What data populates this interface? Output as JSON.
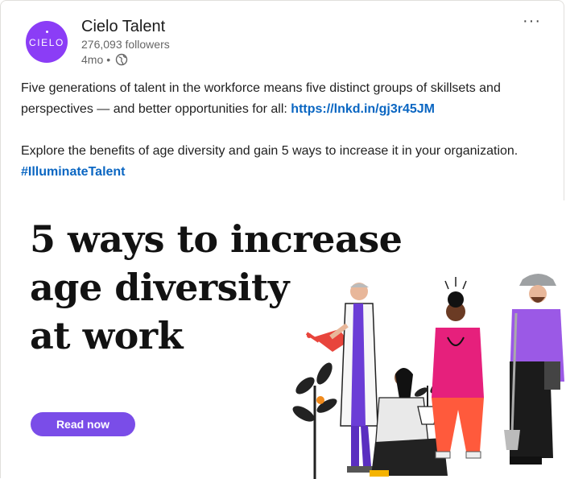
{
  "company": {
    "name": "Cielo Talent",
    "logo_text": "CIELO",
    "followers": "276,093 followers",
    "posted": "4mo",
    "separator": "•",
    "brand_color": "#8b3df6"
  },
  "menu": {
    "more_label": "···"
  },
  "post": {
    "paragraph1": "Five generations of talent in the workforce means five distinct groups of skillsets and perspectives — and better opportunities for all: ",
    "link": "https://lnkd.in/gj3r45JM",
    "paragraph2": "Explore the benefits of age diversity and gain 5 ways to increase it in your organization. ",
    "hashtag": "#IlluminateTalent",
    "link_color": "#0a66c2"
  },
  "banner": {
    "headline_lines": [
      "5 ways to increase",
      "age diversity",
      "at work"
    ],
    "cta_label": "Read now",
    "cta_color": "#7a4de8"
  }
}
